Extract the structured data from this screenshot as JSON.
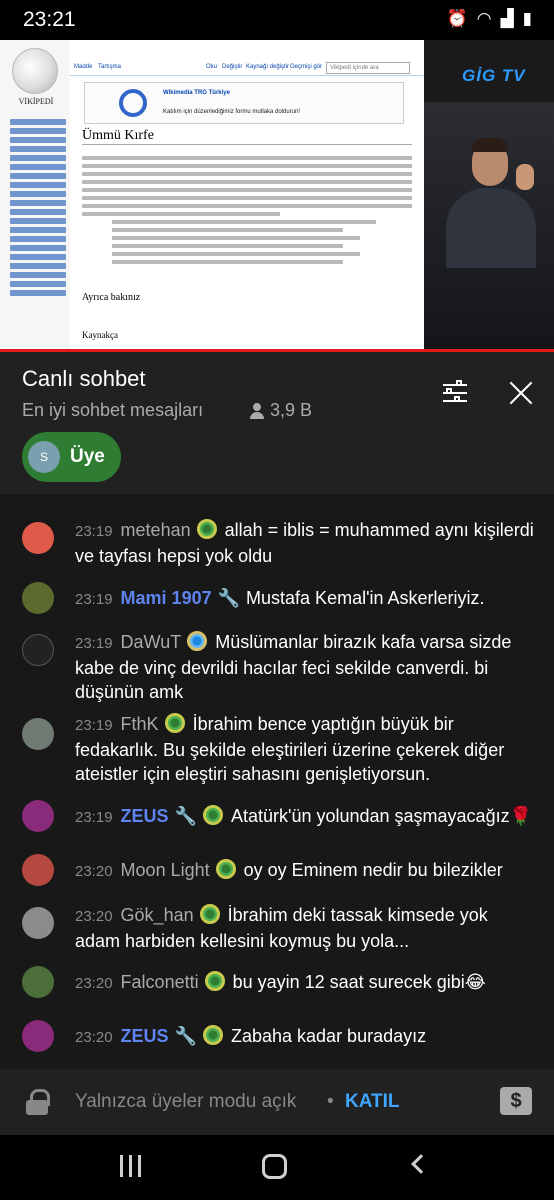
{
  "status_bar": {
    "time": "23:21",
    "icons": [
      "alarm-icon",
      "wifi-icon",
      "signal-icon",
      "battery-icon"
    ]
  },
  "video": {
    "channel_brand": "GİG TV",
    "wiki": {
      "logo_text": "VİKİPEDİ",
      "tabs": [
        "Madde",
        "Tartışma",
        "Oku",
        "Değiştir",
        "Kaynağı değiştir",
        "Geçmişi gör"
      ],
      "search_placeholder": "Vikipedi içinde ara",
      "banner_org": "Wikimedia TRG Türkiye",
      "banner_footer": "Katılım için düzenlediğimiz formu mutlaka doldurun!",
      "article_title": "Ümmü Kırfe",
      "section_see_also": "Ayrıca bakınız",
      "section_sources": "Kaynakça"
    }
  },
  "chat": {
    "title": "Canlı sohbet",
    "subtitle": "En iyi sohbet mesajları",
    "viewer_count": "3,9 B",
    "chip": {
      "initial": "S",
      "label": "Üye"
    },
    "messages": [
      {
        "time": "23:19",
        "author": "metehan",
        "moderator": false,
        "badge": "member",
        "text": "allah = iblis = muhammed aynı kişilerdi ve tayfası hepsi yok oldu"
      },
      {
        "time": "23:19",
        "author": "Mami 1907",
        "moderator": true,
        "badge": "",
        "text": "Mustafa Kemal'in Askerleriyiz."
      },
      {
        "time": "23:19",
        "author": "DaWuT",
        "moderator": false,
        "badge": "member-blue",
        "text": "Müslümanlar birazık kafa varsa sizde kabe de vinç devrildi hacılar feci sekilde canverdi. bi düşünün amk"
      },
      {
        "time": "23:19",
        "author": "FthK",
        "moderator": false,
        "badge": "member",
        "text": "İbrahim bence yaptığın büyük bir fedakarlık. Bu şekilde eleştirileri üzerine çekerek diğer ateistler için eleştiri sahasını genişletiyorsun."
      },
      {
        "time": "23:19",
        "author": "ZEUS",
        "moderator": true,
        "badge": "member",
        "text": "Atatürk'ün yolundan şaşmayacağız🌹"
      },
      {
        "time": "23:20",
        "author": "Moon Light",
        "moderator": false,
        "badge": "member",
        "text": "oy oy Eminem nedir bu bilezikler"
      },
      {
        "time": "23:20",
        "author": "Gök_han",
        "moderator": false,
        "badge": "member",
        "text": "İbrahim deki tassak kimsede yok adam harbiden kellesini koymuş bu yola..."
      },
      {
        "time": "23:20",
        "author": "Falconetti",
        "moderator": false,
        "badge": "member",
        "text": "bu yayin 12 saat surecek gibi😂"
      },
      {
        "time": "23:20",
        "author": "ZEUS",
        "moderator": true,
        "badge": "member",
        "text": "Zabaha kadar buradayız"
      }
    ],
    "footer": {
      "members_only_text": "Yalnızca üyeler modu açık",
      "separator": "•",
      "join_label": "KATIL"
    }
  }
}
